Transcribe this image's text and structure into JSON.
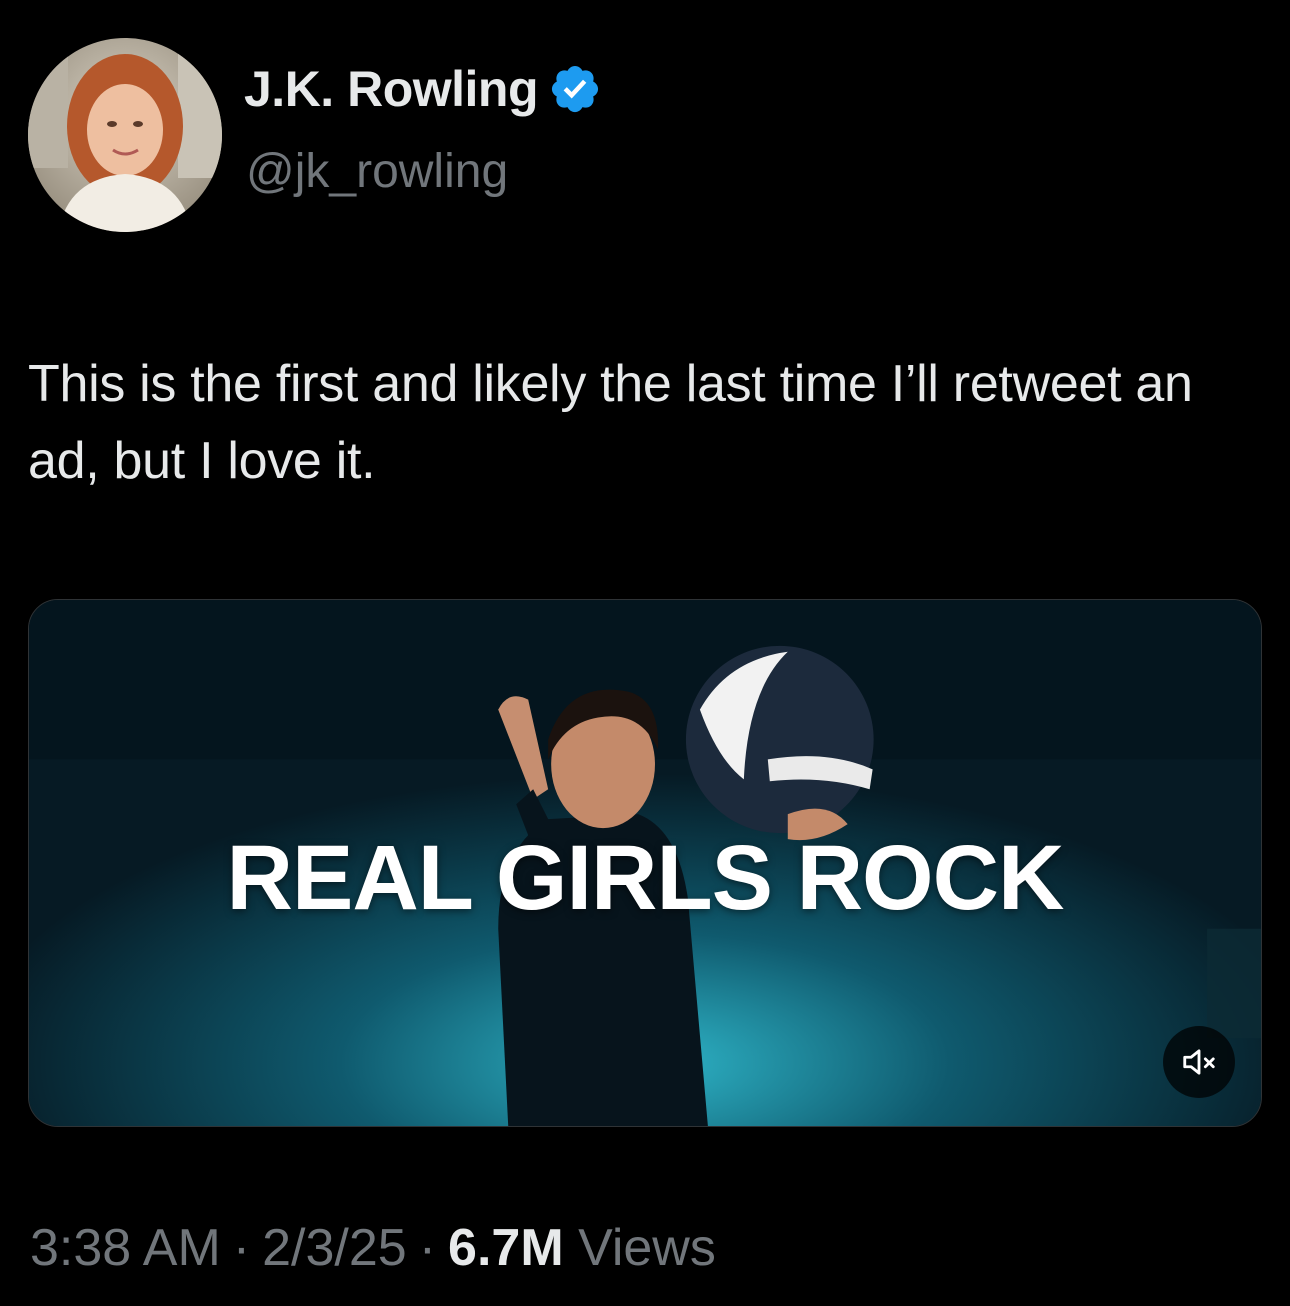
{
  "author": {
    "display_name": "J.K. Rowling",
    "handle": "@jk_rowling",
    "verified": true,
    "verified_color": "#1d9bf0"
  },
  "tweet": {
    "text": "This is the first and likely the last time I’ll retweet an ad, but I love it."
  },
  "media": {
    "type": "video",
    "caption": "REAL GIRLS ROCK",
    "mute_icon": "speaker-muted-icon"
  },
  "meta": {
    "time": "3:38 AM",
    "separator": "·",
    "date": "2/3/25",
    "views_count": "6.7M",
    "views_label": "Views"
  },
  "colors": {
    "background": "#000000",
    "primary_text": "#e7e9ea",
    "secondary_text": "#71767b",
    "accent": "#1d9bf0"
  }
}
